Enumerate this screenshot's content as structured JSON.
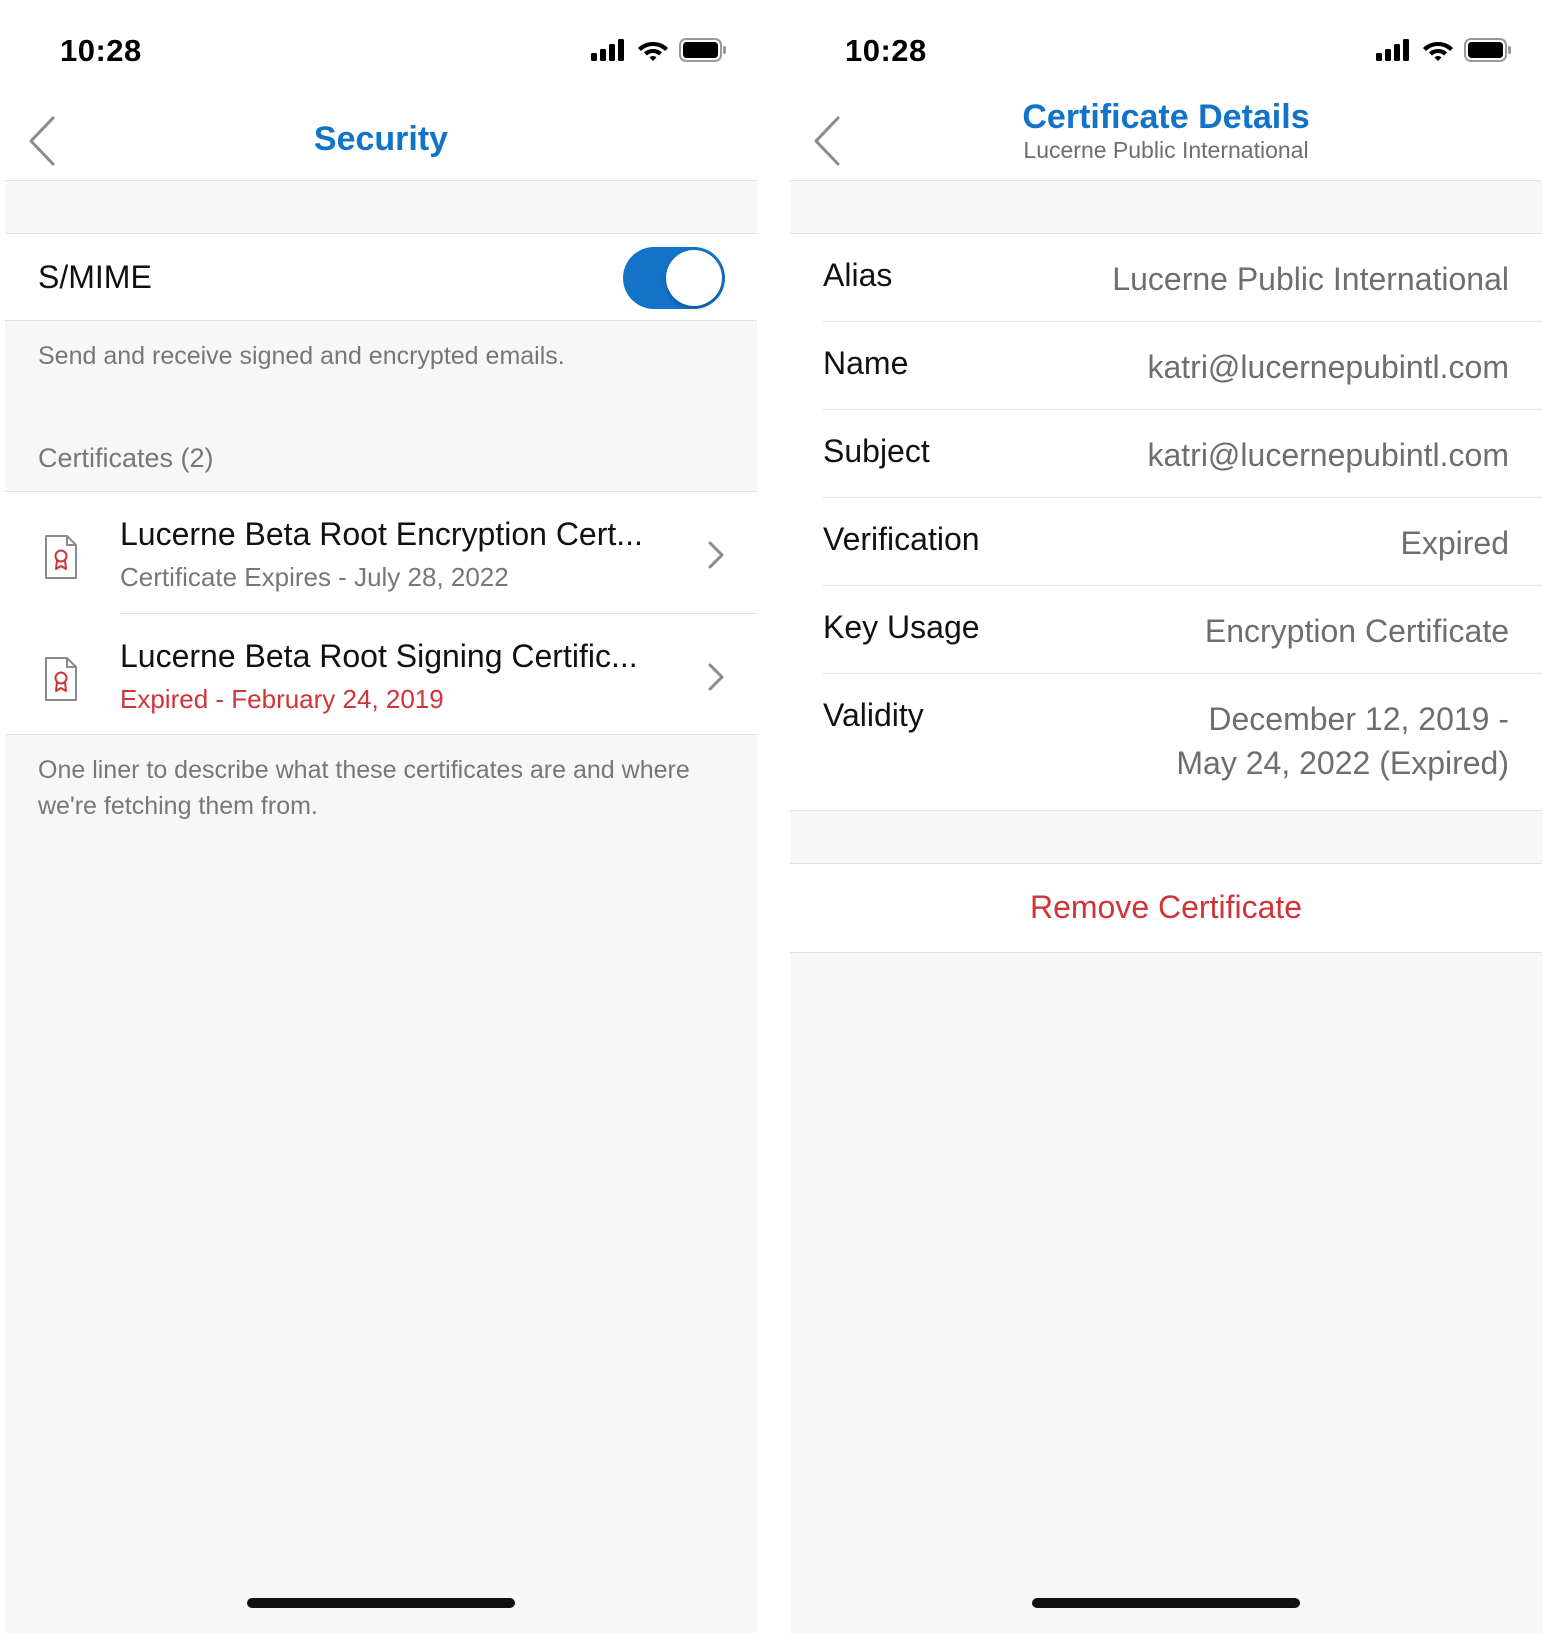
{
  "colors": {
    "accent": "#1273c9",
    "destructive": "#d13438",
    "secondary_text": "#777777",
    "background": "#f7f7f7"
  },
  "left_screen": {
    "status_bar": {
      "time": "10:28",
      "icons": [
        "cellular-signal-icon",
        "wifi-icon",
        "battery-icon"
      ]
    },
    "nav": {
      "back_icon": "chevron-left-icon",
      "title": "Security"
    },
    "smime": {
      "label": "S/MIME",
      "toggle_on": true,
      "description": "Send and receive signed and encrypted emails."
    },
    "certificates": {
      "header": "Certificates (2)",
      "items": [
        {
          "icon": "certificate-icon",
          "title": "Lucerne Beta Root Encryption Cert...",
          "subtitle": "Certificate Expires - July 28, 2022",
          "expired": false
        },
        {
          "icon": "certificate-icon",
          "title": "Lucerne Beta Root Signing Certific...",
          "subtitle": "Expired - February 24, 2019",
          "expired": true
        }
      ],
      "description": "One liner to describe what these certificates are and where we're fetching them from."
    }
  },
  "right_screen": {
    "status_bar": {
      "time": "10:28",
      "icons": [
        "cellular-signal-icon",
        "wifi-icon",
        "battery-icon"
      ]
    },
    "nav": {
      "back_icon": "chevron-left-icon",
      "title": "Certificate Details",
      "subtitle": "Lucerne Public International"
    },
    "details": [
      {
        "label": "Alias",
        "value": "Lucerne Public International"
      },
      {
        "label": "Name",
        "value": "katri@lucernepubintl.com"
      },
      {
        "label": "Subject",
        "value": "katri@lucernepubintl.com"
      },
      {
        "label": "Verification",
        "value": "Expired"
      },
      {
        "label": "Key Usage",
        "value": "Encryption Certificate"
      },
      {
        "label": "Validity",
        "value_line1": "December 12, 2019 -",
        "value_line2": "May 24, 2022 (Expired)"
      }
    ],
    "remove_button": "Remove Certificate"
  }
}
